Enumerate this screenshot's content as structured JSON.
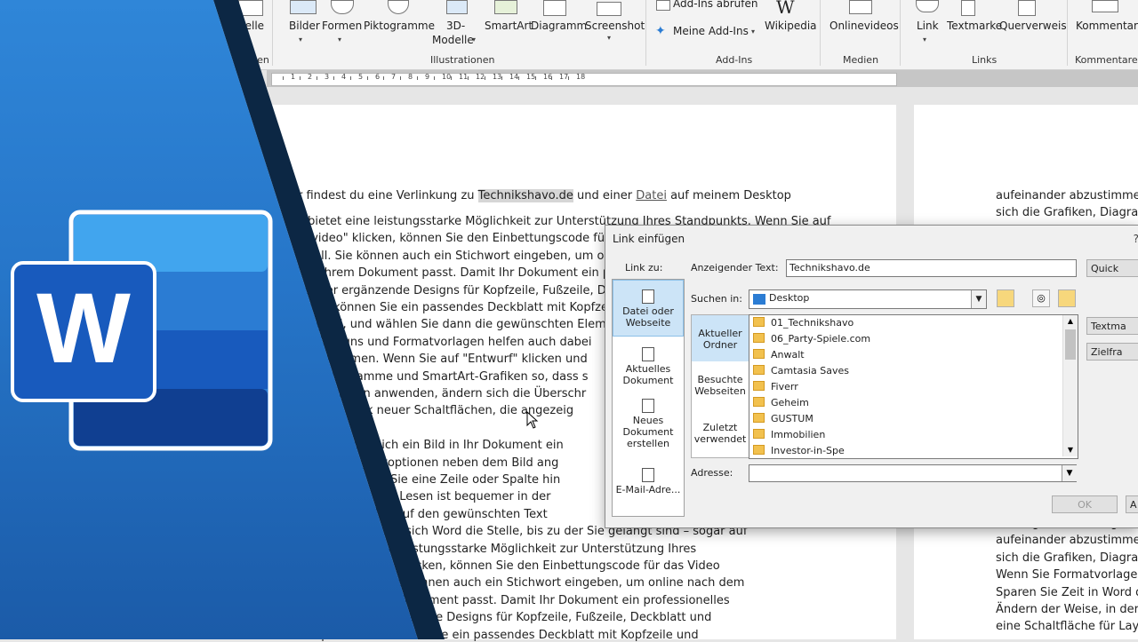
{
  "ribbon": {
    "buttons": {
      "tabelle": "belle",
      "bilder": "Bilder",
      "formen": "Formen",
      "piktogramme": "Piktogramme",
      "modelle_1": "3D-",
      "modelle_2": "Modelle",
      "smartart": "SmartArt",
      "diagramm": "Diagramm",
      "screenshot": "Screenshot",
      "addins_abrufen": "Add-Ins abrufen",
      "meine_addins": "Meine Add-Ins",
      "wikipedia": "Wikipedia",
      "onlinevideos": "Onlinevideos",
      "link": "Link",
      "textmarke": "Textmarke",
      "querverweis": "Querverweis",
      "kommentar": "Kommentar"
    },
    "groups": {
      "tabellen": "llen",
      "illustrationen": "Illustrationen",
      "addins": "Add-Ins",
      "medien": "Medien",
      "links": "Links",
      "kommentare": "Kommentare"
    }
  },
  "ruler": {
    "numbers": [
      "1",
      "2",
      "3",
      "4",
      "5",
      "6",
      "7",
      "8",
      "9",
      "10",
      "11",
      "12",
      "13",
      "14",
      "15",
      "16",
      "17",
      "18"
    ]
  },
  "document": {
    "line0_pre": "r findest du eine Verlinkung zu ",
    "line0_hl": "Technikshavo.de",
    "line0_mid": " und einer ",
    "line0_link": "Datei",
    "line0_post": " auf meinem Desktop",
    "lines": [
      "o bietet eine leistungsstarke Möglichkeit zur Unterstützung Ihres Standpunkts. Wenn Sie auf",
      "nevideo\" klicken, können Sie den Einbettungscode für das",
      "n soll. Sie können auch ein Stichwort eingeben, um onlin",
      "l zu Ihrem Dokument passt. Damit Ihr Dokument ein prof",
      "nander ergänzende Designs für Kopfzeile, Fußzeile, De",
      "weise können Sie ein passendes Deckblatt mit Kopfze",
      "nfügen\", und wählen Sie dann die gewünschten Elem",
      "us. Designs und Formatvorlagen helfen auch dabei",
      " abzustimmen. Wenn Sie auf \"Entwurf\" klicken und",
      "ken, Diagramme und SmartArt-Grafiken so, dass s",
      "matvorlagen anwenden, ändern sich die Überschr",
      " in Word dank neuer Schaltflächen, die angezeig",
      "",
      " Weise, in der sich ein Bild in Ihr Dokument ein",
      "äche für Layoutoptionen neben dem Bild ang",
      "Position, an der Sie eine Zeile oder Spalte hin",
      "eichen. Auch das Lesen ist bequemer in der",
      "uzieren und sich auf den gewünschten Text",
      "en müssen, merkt sich Word die Stelle, bis zu der Sie gelangt sind – sogar auf",
      " Video bietet eine leistungsstarke Möglichkeit zur Unterstützung Ihres",
      " auf \"Onlinevideo\" klicken, können Sie den Einbettungscode für das Video",
      "gt werden soll. Sie können auch ein Stichwort eingeben, um online nach dem",
      "optimal zu Ihrem Dokument passt. Damit Ihr Dokument ein professionelles",
      "ord einander ergänzende Designs für Kopfzeile, Fußzeile, Deckblatt und",
      "Beispielsweise können Sie ein passendes Deckblatt mit Kopfzeile und"
    ],
    "right_top": [
      "aufeinander abzustimmen.",
      "sich die Grafiken, Diagramm"
    ],
    "right_bottom": [
      "Katalogen aus. Designs und",
      "aufeinander abzustimmen.",
      "sich die Grafiken, Diagramm",
      "Wenn Sie Formatvorlagen a",
      "Sparen Sie Zeit in Word dar",
      "Ändern der Weise, in der si",
      "eine Schaltfläche für Layou"
    ]
  },
  "dialog": {
    "title": "Link einfügen",
    "help": "?",
    "link_zu": "Link zu:",
    "link_targets": {
      "datei_webseite": "Datei oder Webseite",
      "aktuelles_dokument": "Aktuelles Dokument",
      "neues_dokument": "Neues Dokument erstellen",
      "email": "E-Mail-Adre..."
    },
    "anzeige_label": "Anzeigender Text:",
    "anzeige_value": "Technikshavo.de",
    "quickinfo": "Quick",
    "suchen_label": "Suchen in:",
    "suchen_value": "Desktop",
    "nav": {
      "aktueller_ordner": "Aktueller Ordner",
      "besuchte_webseiten": "Besuchte Webseiten",
      "zuletzt_verwendet": "Zuletzt verwendet"
    },
    "files": [
      "01_Technikshavo",
      "06_Party-Spiele.com",
      "Anwalt",
      "Camtasia Saves",
      "Fiverr",
      "Geheim",
      "GUSTUM",
      "Immobilien",
      "Investor-in-Spe"
    ],
    "textmarke": "Textma",
    "zielframe": "Zielfra",
    "adresse_label": "Adresse:",
    "adresse_value": "",
    "ok": "OK",
    "abbrechen": "A"
  },
  "logo": {
    "letter": "W"
  },
  "colors": {
    "word_blue": "#2b7cd3",
    "word_dark": "#185abd",
    "selection": "#cce4f7"
  }
}
